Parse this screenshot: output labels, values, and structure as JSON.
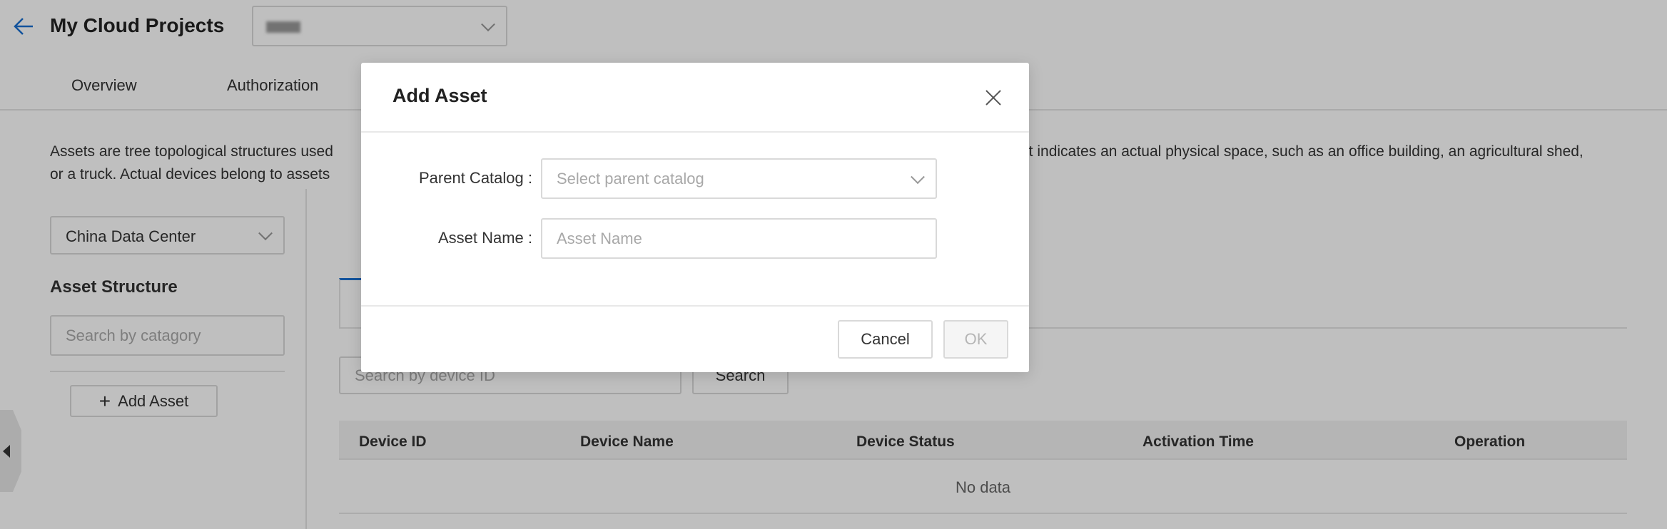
{
  "header": {
    "title": "My Cloud Projects",
    "project_select_value": "[blurred]"
  },
  "tabs": [
    {
      "label": "Overview"
    },
    {
      "label": "Authorization"
    }
  ],
  "description": {
    "line1_left": "Assets are tree topological structures used",
    "line1_right": "et indicates an actual physical space, such as an office building, an agricultural shed,",
    "line2_left": "or a truck. Actual devices belong to assets"
  },
  "sidebar": {
    "region_select": "China Data Center",
    "section_title": "Asset Structure",
    "search_placeholder": "Search by catagory",
    "add_asset_label": "Add Asset"
  },
  "main": {
    "search_placeholder": "Search by device ID",
    "search_button": "Search",
    "table": {
      "columns": [
        "Device ID",
        "Device Name",
        "Device Status",
        "Activation Time",
        "Operation"
      ],
      "empty_text": "No data"
    }
  },
  "modal": {
    "title": "Add Asset",
    "parent_label": "Parent Catalog",
    "parent_placeholder": "Select parent catalog",
    "name_label": "Asset Name",
    "name_placeholder": "Asset Name",
    "cancel": "Cancel",
    "ok": "OK"
  },
  "colors": {
    "accent": "#1a6fd1",
    "overlay": "rgba(0,0,0,0.25)"
  }
}
